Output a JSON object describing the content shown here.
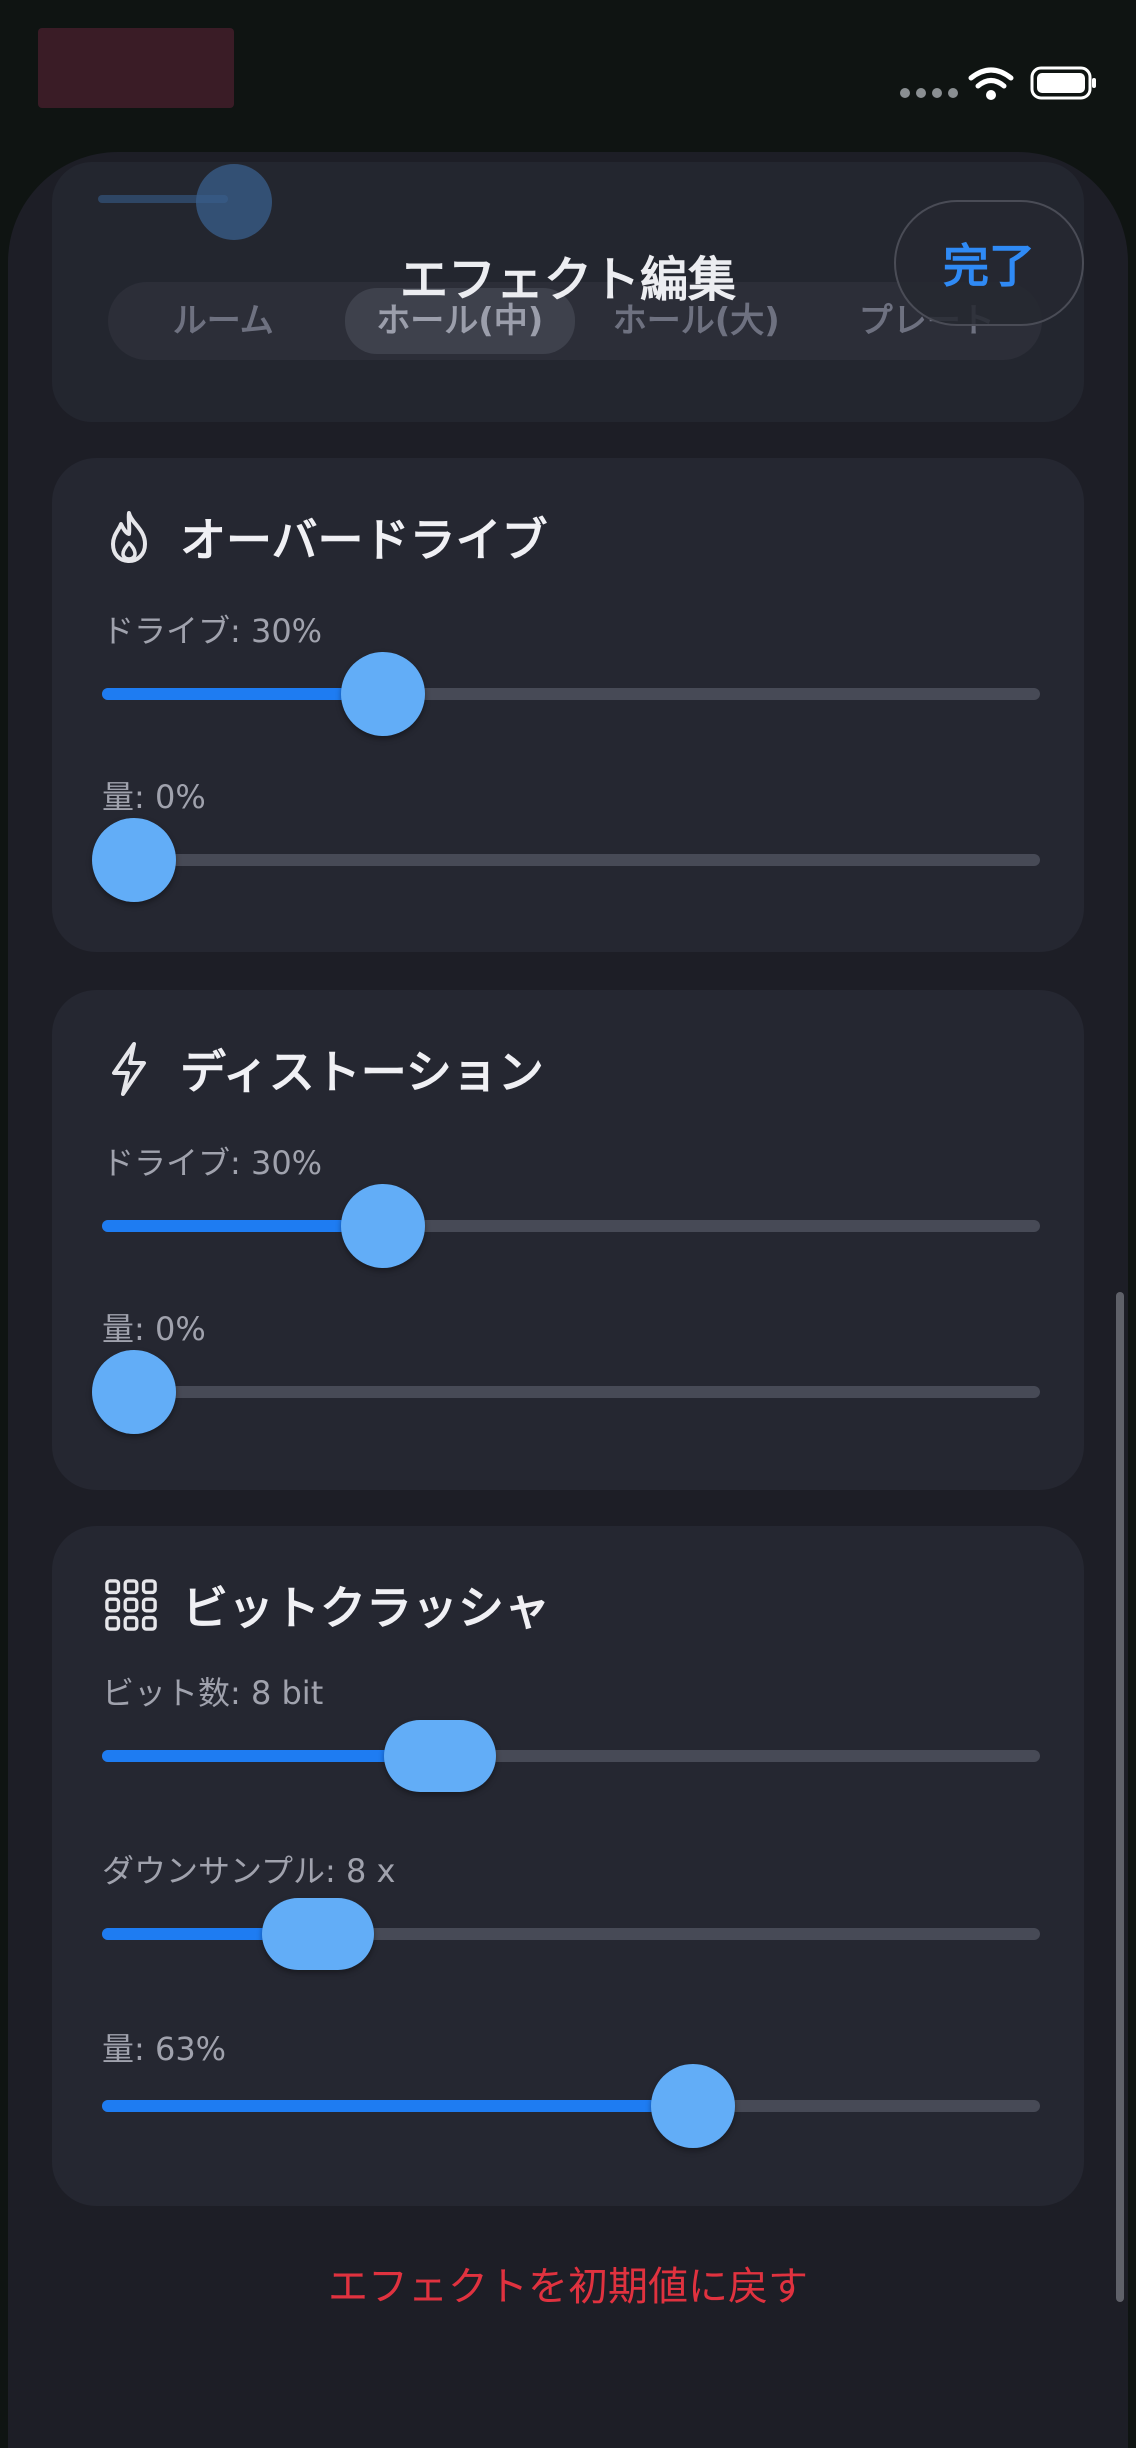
{
  "header": {
    "title": "エフェクト編集",
    "done_label": "完了"
  },
  "presets": {
    "items": [
      "ルーム",
      "ホール(中)",
      "ホール(大)",
      "プレート"
    ],
    "selected": "ホール(中)"
  },
  "overdrive": {
    "title": "オーバードライブ",
    "icon": "flame-icon",
    "drive_label": "ドライブ: 30%",
    "drive_value": 0.3,
    "amount_label": "量: 0%",
    "amount_value": 0.0
  },
  "distortion": {
    "title": "ディストーション",
    "icon": "bolt-icon",
    "drive_label": "ドライブ: 30%",
    "drive_value": 0.3,
    "amount_label": "量: 0%",
    "amount_value": 0.0
  },
  "bitcrusher": {
    "title": "ビットクラッシャ",
    "icon": "grid-icon",
    "bits_label": "ビット数: 8 bit",
    "bits_value": 0.36,
    "downsample_label": "ダウンサンプル: 8 x",
    "downsample_value": 0.23,
    "amount_label": "量: 63%",
    "amount_value": 0.63
  },
  "reset_label": "エフェクトを初期値に戻す",
  "colors": {
    "accent": "#1e7cf2",
    "knob": "#62adf7",
    "destructive": "#e0323f",
    "card": "#252731",
    "sheet": "#1d1e26"
  }
}
